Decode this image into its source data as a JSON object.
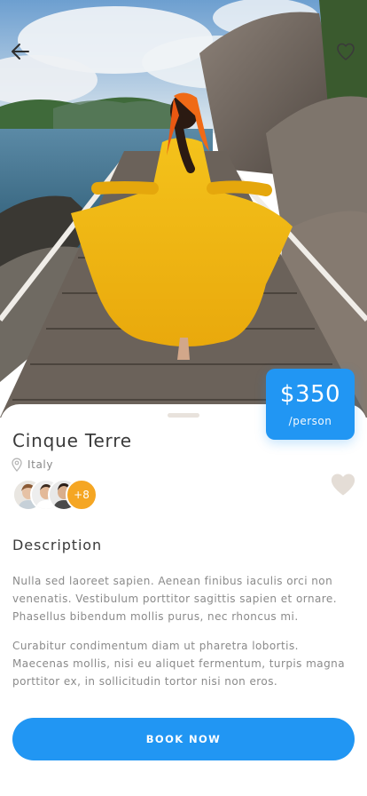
{
  "hero": {
    "back_icon": "arrow-left-icon",
    "favorite_icon": "heart-outline-icon"
  },
  "price": {
    "amount": "$350",
    "unit": "/person"
  },
  "destination": {
    "title": "Cinque Terre",
    "location": "Italy",
    "location_icon": "map-pin-icon"
  },
  "travelers": {
    "more_label": "+8",
    "avatar_count": 3
  },
  "favorite_icon": "heart-filled-icon",
  "description": {
    "heading": "Description",
    "paragraphs": [
      "Nulla sed laoreet sapien. Aenean finibus iaculis orci non venenatis. Vestibulum porttitor sagittis sapien et ornare. Phasellus bibendum mollis purus, nec rhoncus mi.",
      "Curabitur condimentum diam ut pharetra lobortis. Maecenas mollis, nisi eu aliquet fermentum, turpis magna porttitor ex, in sollicitudin tortor nisi non eros."
    ]
  },
  "actions": {
    "book_label": "BOOK NOW"
  },
  "colors": {
    "accent": "#2196f3",
    "badge": "#f5a623",
    "heart": "#e4ddd6"
  }
}
